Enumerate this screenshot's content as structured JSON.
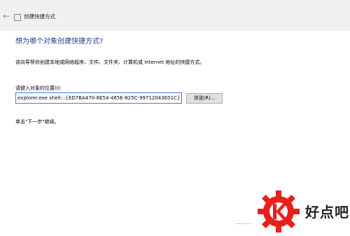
{
  "window": {
    "title": "创建快捷方式"
  },
  "wizard": {
    "heading": "想为哪个对象创建快捷方式?",
    "description": "该向导帮你创建本地或网络程序、文件、文件夹、计算机或 Internet 地址的快捷方式。",
    "location_label": "请键入对象的位置(I):",
    "location_value": "explorer.exe shell:::{ED7BA470-8E54-465E-825C-99712043E01C}",
    "browse_label": "浏览(R)...",
    "hint": "单击\"下一步\"继续。"
  },
  "watermark": {
    "logo_icon": "gear-k-logo",
    "text": "好点吧",
    "accent_color": "#e8201c"
  }
}
